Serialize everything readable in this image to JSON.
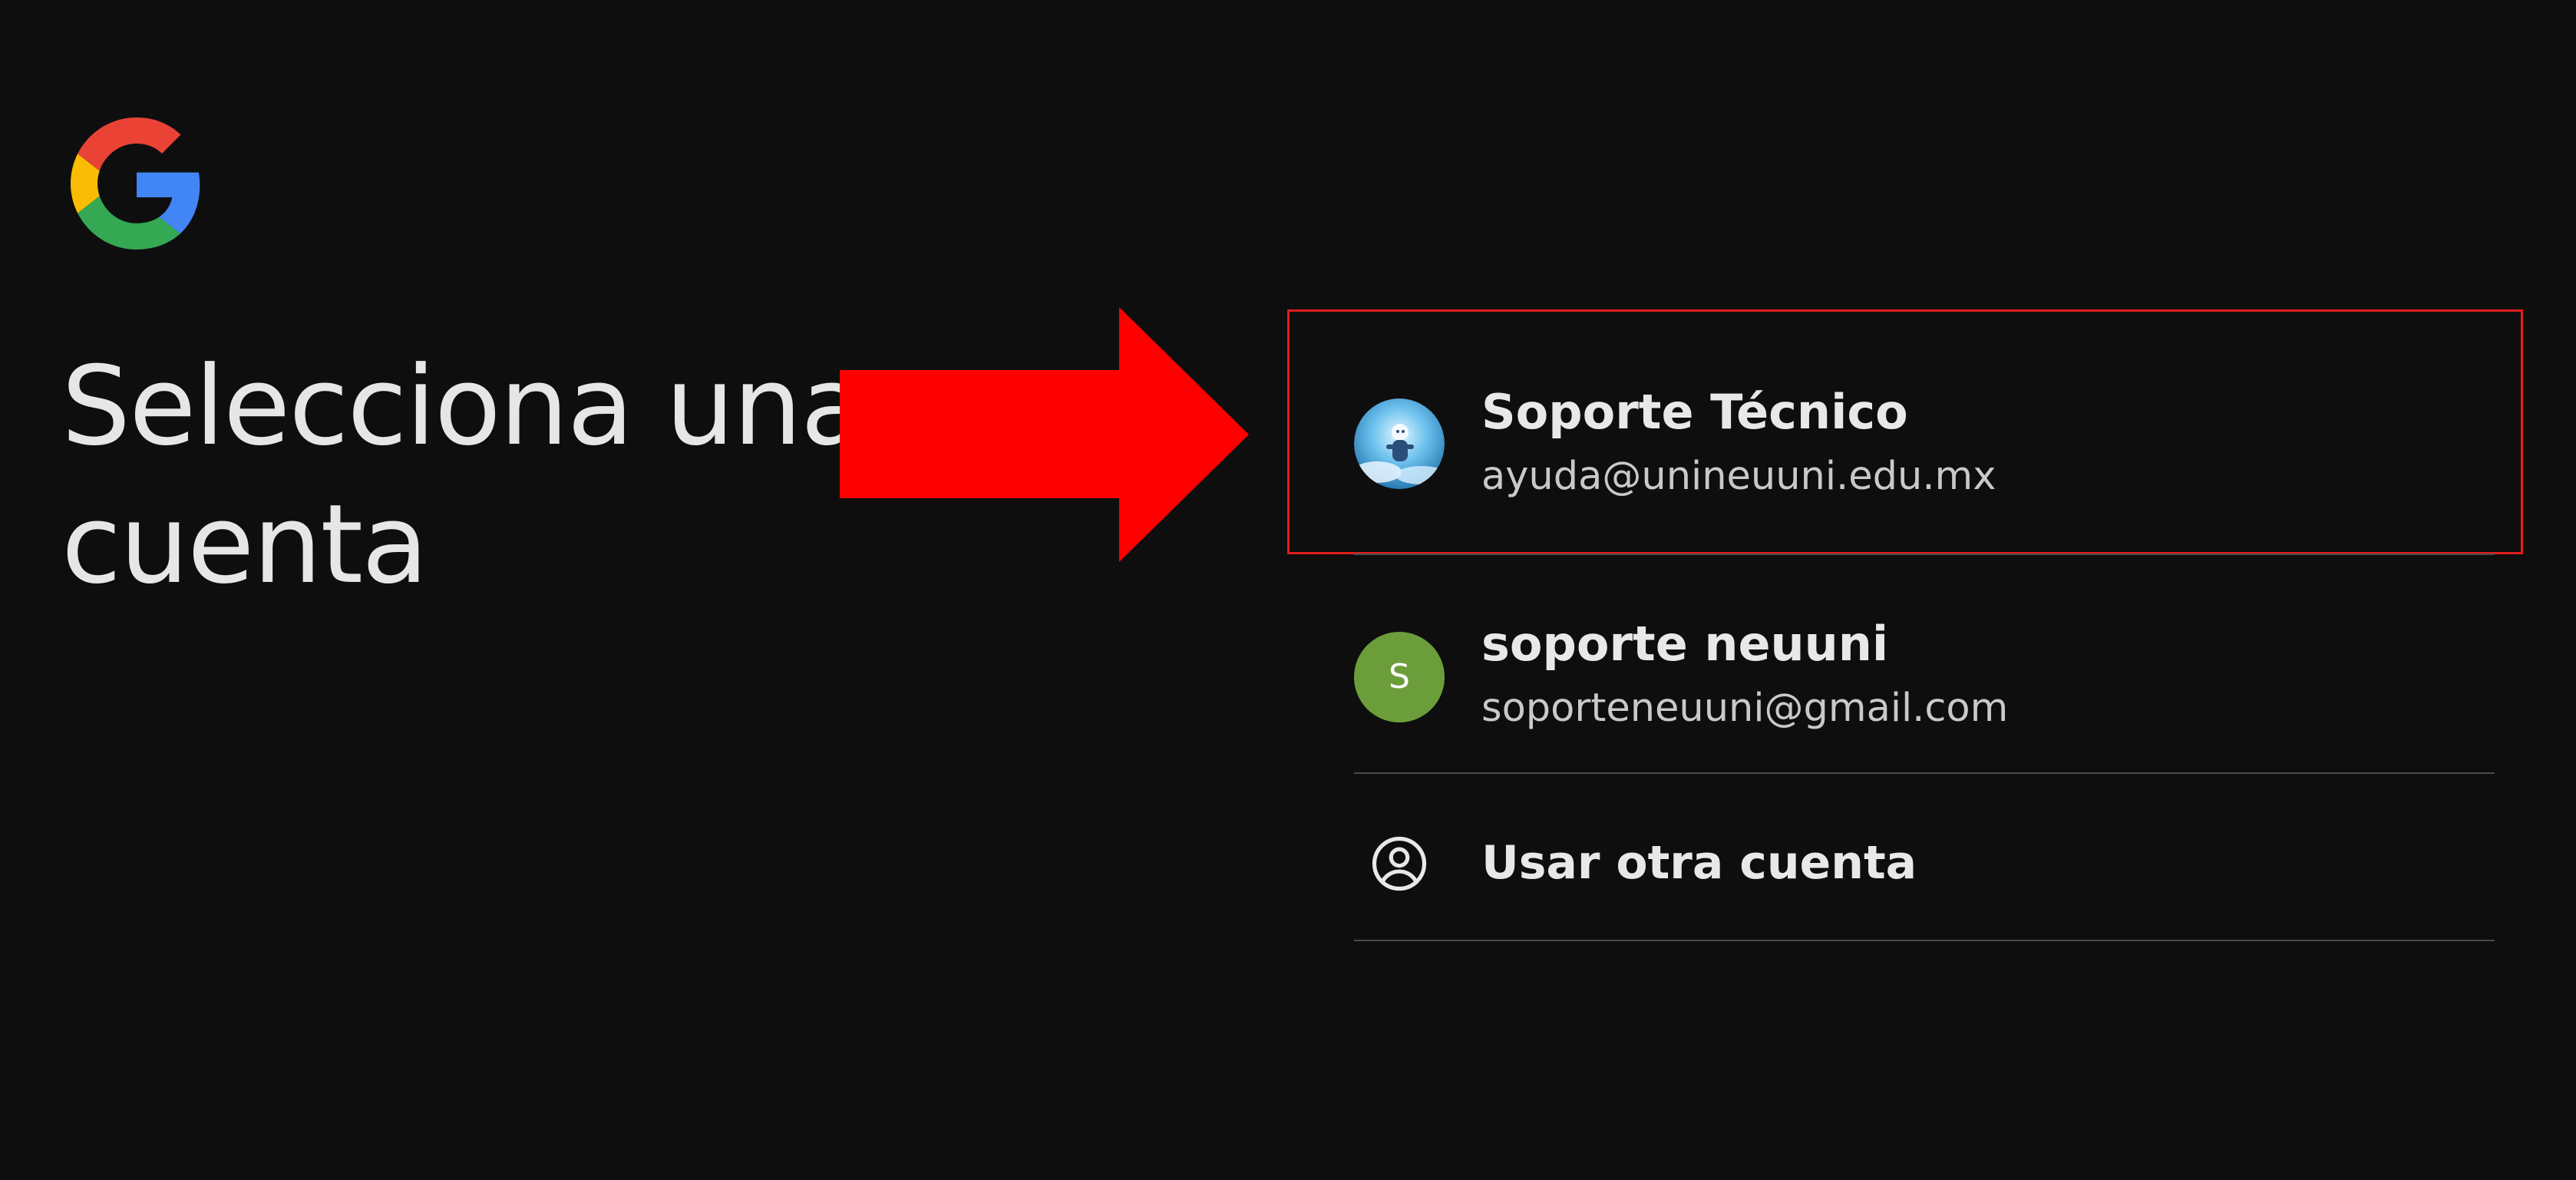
{
  "header": {
    "logo_icon": "google-g-icon",
    "title": "Selecciona una cuenta"
  },
  "accounts": [
    {
      "name": "Soporte Técnico",
      "email": "ayuda@unineuuni.edu.mx",
      "avatar": "profile-photo",
      "highlighted": true
    },
    {
      "name": "soporte neuuni",
      "email": "soporteneuuni@gmail.com",
      "avatar_letter": "S",
      "avatar_color": "#6b9e3a"
    }
  ],
  "other_account": {
    "label": "Usar otra cuenta",
    "icon": "account-circle-icon"
  },
  "annotation": {
    "arrow_color": "#ff0000",
    "box_color": "#e21d1d"
  },
  "colors": {
    "background": "#0e0e0f",
    "divider": "#4a4a4c",
    "google_blue": "#4285F4",
    "google_red": "#EA4335",
    "google_yellow": "#FBBC05",
    "google_green": "#34A853"
  }
}
